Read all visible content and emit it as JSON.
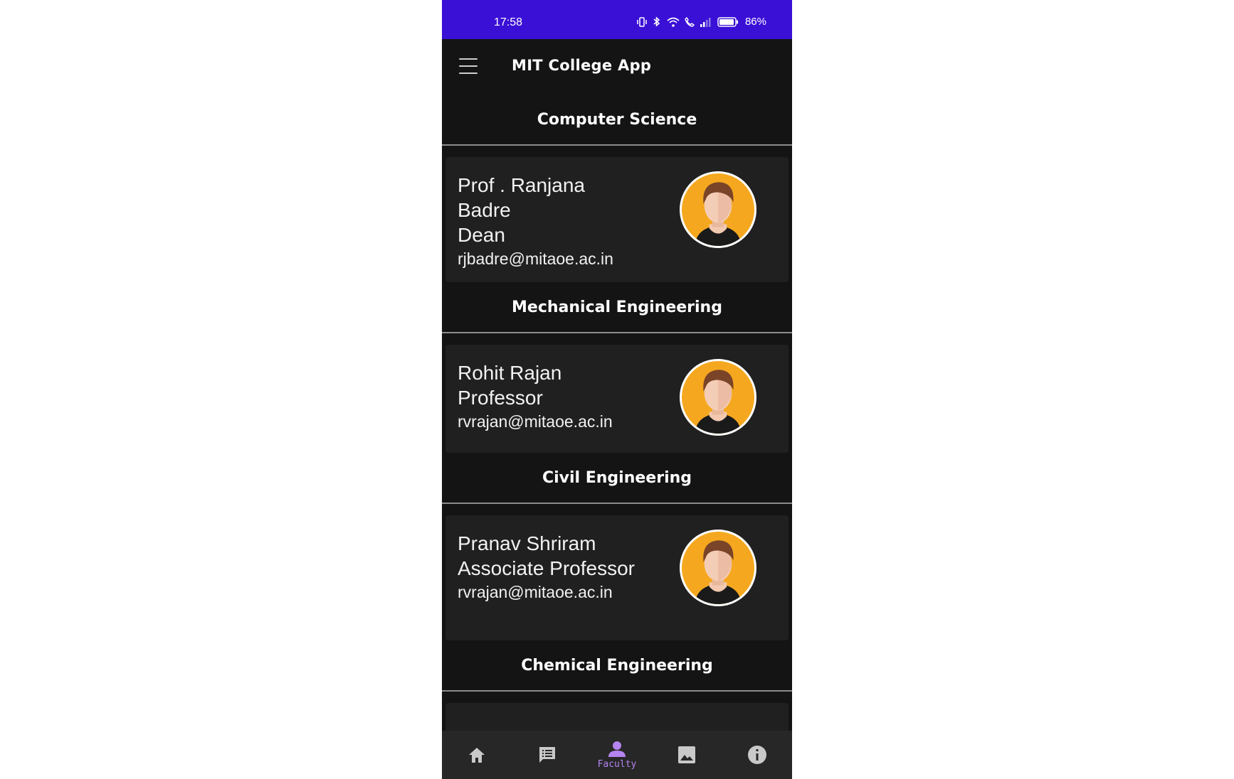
{
  "status_bar": {
    "time": "17:58",
    "battery_percent": "86%"
  },
  "app_bar": {
    "title": "MIT College App",
    "menu_icon": "hamburger-menu-icon"
  },
  "sections": [
    {
      "department": "Computer Science",
      "faculty": {
        "name": "Prof . Ranjana Badre",
        "role": "Dean",
        "email": "rjbadre@mitaoe.ac.in"
      }
    },
    {
      "department": "Mechanical Engineering",
      "faculty": {
        "name": "Rohit Rajan",
        "role": "Professor",
        "email": "rvrajan@mitaoe.ac.in"
      }
    },
    {
      "department": "Civil Engineering",
      "faculty": {
        "name": "Pranav Shriram",
        "role": "Associate Professor",
        "email": "rvrajan@mitaoe.ac.in"
      }
    },
    {
      "department": "Chemical Engineering"
    }
  ],
  "bottom_nav": {
    "items": [
      {
        "icon": "home-icon",
        "label": ""
      },
      {
        "icon": "notice-icon",
        "label": ""
      },
      {
        "icon": "person-icon",
        "label": "Faculty",
        "active": true
      },
      {
        "icon": "gallery-icon",
        "label": ""
      },
      {
        "icon": "info-icon",
        "label": ""
      }
    ]
  },
  "colors": {
    "status_bar": "#3a10d6",
    "background": "#141414",
    "card": "#202020",
    "avatar_bg": "#f5a81f",
    "accent": "#b584f0"
  }
}
